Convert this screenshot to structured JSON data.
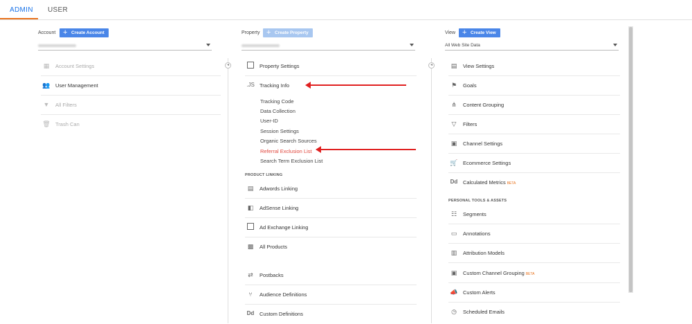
{
  "tabs": [
    {
      "label": "ADMIN"
    },
    {
      "label": "USER"
    }
  ],
  "account": {
    "label": "Account",
    "create_label": "Create Account",
    "items": [
      {
        "label": "Account Settings",
        "icon": "building-icon"
      },
      {
        "label": "User Management",
        "icon": "users-icon"
      },
      {
        "label": "All Filters",
        "icon": "filter-icon"
      },
      {
        "label": "Trash Can",
        "icon": "trash-icon"
      }
    ]
  },
  "property": {
    "label": "Property",
    "create_label": "Create Property",
    "items": [
      {
        "label": "Property Settings",
        "icon": "settings-window-icon"
      },
      {
        "label": "Tracking Info",
        "icon": "js-icon"
      }
    ],
    "tracking_sub": [
      "Tracking Code",
      "Data Collection",
      "User-ID",
      "Session Settings",
      "Organic Search Sources",
      "Referral Exclusion List",
      "Search Term Exclusion List"
    ],
    "product_linking_label": "PRODUCT LINKING",
    "linking_items": [
      {
        "label": "Adwords Linking",
        "icon": "adwords-icon"
      },
      {
        "label": "AdSense Linking",
        "icon": "adsense-icon"
      },
      {
        "label": "Ad Exchange Linking",
        "icon": "adexchange-icon"
      },
      {
        "label": "All Products",
        "icon": "all-products-icon"
      }
    ],
    "other_items": [
      {
        "label": "Postbacks",
        "icon": "postbacks-icon"
      },
      {
        "label": "Audience Definitions",
        "icon": "audience-icon"
      },
      {
        "label": "Custom Definitions",
        "icon": "dd-icon"
      }
    ]
  },
  "view": {
    "label": "View",
    "create_label": "Create View",
    "selected": "All Web Site Data",
    "items": [
      {
        "label": "View Settings",
        "icon": "document-icon"
      },
      {
        "label": "Goals",
        "icon": "flag-icon"
      },
      {
        "label": "Content Grouping",
        "icon": "grouping-icon"
      },
      {
        "label": "Filters",
        "icon": "filter-icon"
      },
      {
        "label": "Channel Settings",
        "icon": "channel-icon"
      },
      {
        "label": "Ecommerce Settings",
        "icon": "cart-icon"
      },
      {
        "label": "Calculated Metrics",
        "icon": "dd-icon",
        "badge": "BETA"
      }
    ],
    "personal_label": "PERSONAL TOOLS & ASSETS",
    "personal_items": [
      {
        "label": "Segments",
        "icon": "segments-icon"
      },
      {
        "label": "Annotations",
        "icon": "annotation-icon"
      },
      {
        "label": "Attribution Models",
        "icon": "attribution-icon"
      },
      {
        "label": "Custom Channel Grouping",
        "icon": "channel-icon",
        "badge": "BETA"
      },
      {
        "label": "Custom Alerts",
        "icon": "megaphone-icon"
      },
      {
        "label": "Scheduled Emails",
        "icon": "clock-icon"
      }
    ]
  },
  "colors": {
    "accent": "#1a73e8",
    "button": "#4a86e8",
    "tab_underline": "#e8711b",
    "arrow": "#e02020",
    "active_link": "#e0453b"
  }
}
